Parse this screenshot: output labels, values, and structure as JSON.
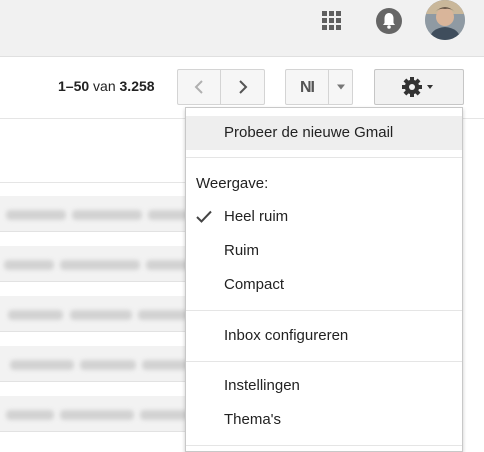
{
  "header": {
    "apps_icon": "apps-grid-icon",
    "notifications_icon": "bell-icon",
    "avatar_icon": "user-avatar"
  },
  "toolbar": {
    "pager": {
      "range": "1–50",
      "of": "van",
      "total": "3.258"
    },
    "prev_icon": "chevron-left-icon",
    "next_icon": "chevron-right-icon",
    "language_label": "NI",
    "language_caret_icon": "caret-down-icon",
    "settings_icon": "gear-icon"
  },
  "menu": {
    "try_new": "Probeer de nieuwe Gmail",
    "display_heading": "Weergave:",
    "density_options": [
      {
        "label": "Heel ruim",
        "checked": true
      },
      {
        "label": "Ruim",
        "checked": false
      },
      {
        "label": "Compact",
        "checked": false
      }
    ],
    "configure_inbox": "Inbox configureren",
    "settings": "Instellingen",
    "themes": "Thema's"
  },
  "colors": {
    "topbar_bg": "#f1f1f1",
    "menu_highlight": "#eeeeee",
    "icon_gray": "#5f5f5f"
  }
}
